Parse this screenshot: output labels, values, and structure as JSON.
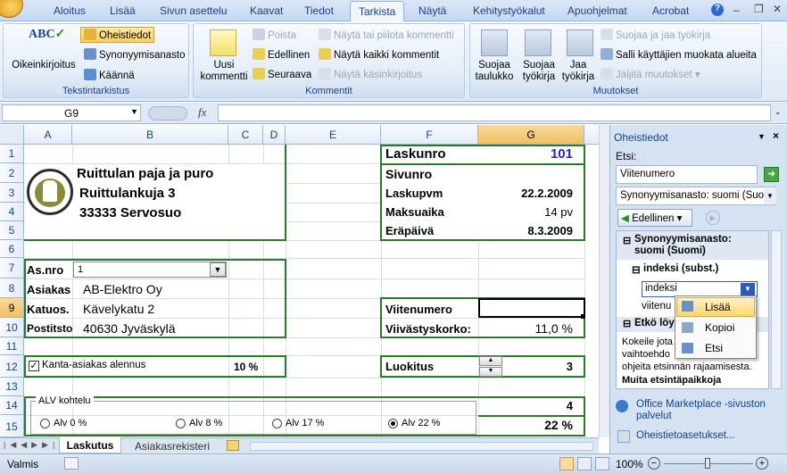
{
  "ribbon_tabs": [
    "Aloitus",
    "Lisää",
    "Sivun asettelu",
    "Kaavat",
    "Tiedot",
    "Tarkista",
    "Näytä",
    "Kehitystyökalut",
    "Apuohjelmat",
    "Acrobat"
  ],
  "active_tab": "Tarkista",
  "ribbon": {
    "proofing": {
      "spell": "Oikeinkirjoitus",
      "research": "Oheistiedot",
      "thesaurus": "Synonyymisanasto",
      "translate": "Käännä",
      "label": "Tekstintarkistus"
    },
    "comments": {
      "new": "Uusi kommentti",
      "delete": "Poista",
      "previous": "Edellinen",
      "next": "Seuraava",
      "show_hide": "Näytä tai piilota kommentti",
      "show_all": "Näytä kaikki kommentit",
      "show_ink": "Näytä käsinkirjoitus",
      "label": "Kommentit"
    },
    "changes": {
      "protect_sheet": "Suojaa taulukko",
      "protect_workbook": "Suojaa työkirja",
      "share_workbook": "Jaa työkirja",
      "protect_share": "Suojaa ja jaa työkirja",
      "allow_edit": "Salli käyttäjien muokata alueita",
      "track": "Jäljitä muutokset",
      "label": "Muutokset"
    }
  },
  "formula_bar": {
    "name_box": "G9",
    "fx": "fx",
    "value": ""
  },
  "columns": [
    "A",
    "B",
    "C",
    "D",
    "E",
    "F",
    "G"
  ],
  "rows": [
    "1",
    "2",
    "3",
    "4",
    "5",
    "6",
    "7",
    "8",
    "9",
    "10",
    "11",
    "12",
    "13",
    "14",
    "15"
  ],
  "sheet": {
    "company_name": "Ruittulan paja ja puro",
    "company_street": "Ruittulankuja 3",
    "company_city": "33333 Servosuo",
    "invoice_no_label": "Laskunro",
    "invoice_no": "101",
    "page_no_label": "Sivunro",
    "invoice_date_label": "Laskupvm",
    "invoice_date": "22.2.2009",
    "payment_time_label": "Maksuaika",
    "payment_time": "14 pv",
    "due_date_label": "Eräpäivä",
    "due_date": "8.3.2009",
    "customer_no_label": "As.nro",
    "customer_no": "1",
    "customer_label": "Asiakas",
    "customer": "AB-Elektro Oy",
    "street_label": "Katuos.",
    "street": "Kävelykatu 2",
    "postal_label": "Postitsto",
    "postal": "40630 Jyväskylä",
    "reference_label": "Viitenumero",
    "late_interest_label": "Viivästyskorko:",
    "late_interest": "11,0 %",
    "regular_discount_label": "Kanta-asiakas alennus",
    "regular_discount": "10 %",
    "class_label": "Luokitus",
    "class_value": "3",
    "vat_group_label": "ALV kohtelu",
    "vat_value": "4",
    "vat_percent": "22 %",
    "vat_options": [
      "Alv 0 %",
      "Alv 8 %",
      "Alv 17 %",
      "Alv 22 %"
    ]
  },
  "sheet_tabs": [
    "Laskutus",
    "Asiakasrekisteri"
  ],
  "status": {
    "ready": "Valmis",
    "zoom": "100%"
  },
  "pane": {
    "title": "Oheistiedot",
    "search_label": "Etsi:",
    "search_value": "Viitenumero",
    "source": "Synonyymisanasto: suomi (Suo",
    "back": "Edellinen",
    "result_header": "Synonyymisanasto: suomi (Suomi)",
    "entry": "indeksi (subst.)",
    "entry_value": "indeksi",
    "second_result": "viitenu",
    "not_found": "Etkö löy",
    "help_text": [
      "Kokeile jota",
      "vaihtoehdo",
      "ohjeita etsinnän rajaamisesta."
    ],
    "other_places": "Muita etsintäpaikkoja",
    "marketplace": "Office Marketplace -sivuston palvelut",
    "options": "Oheistietoasetukset..."
  },
  "context_menu": [
    "Lisää",
    "Kopioi",
    "Etsi"
  ]
}
